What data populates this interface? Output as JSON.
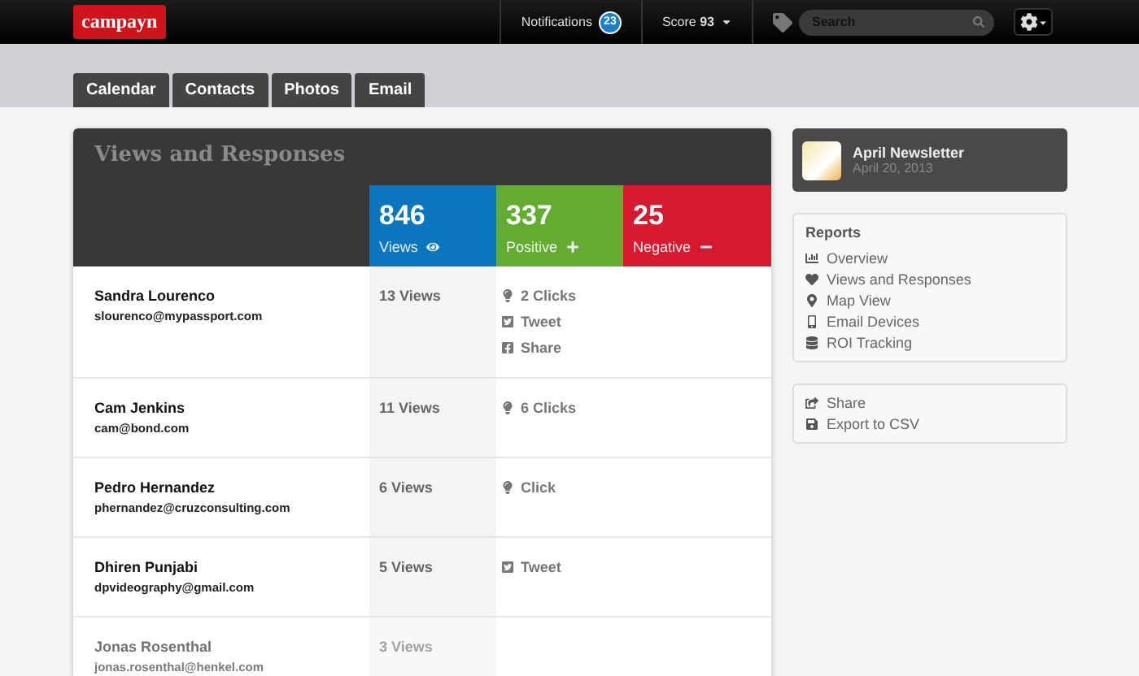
{
  "topbar": {
    "logo": "campayn",
    "notifications": {
      "label": "Notifications",
      "count": "23"
    },
    "score": {
      "label": "Score",
      "value": "93"
    },
    "search": {
      "placeholder": "Search"
    }
  },
  "tabs": [
    {
      "label": "Calendar",
      "selected": false
    },
    {
      "label": "Contacts",
      "selected": false
    },
    {
      "label": "Photos",
      "selected": false
    },
    {
      "label": "Email",
      "selected": false
    }
  ],
  "panel": {
    "title": "Views and Responses",
    "stats": [
      {
        "value": "846",
        "label": "Views",
        "kind": "views",
        "color": "#0b76bd"
      },
      {
        "value": "337",
        "label": "Positive",
        "kind": "positive",
        "color": "#62ac31"
      },
      {
        "value": "25",
        "label": "Negative",
        "kind": "negative",
        "color": "#d61a30"
      }
    ],
    "rows": [
      {
        "name": "Sandra Lourenco",
        "email": "slourenco@mypassport.com",
        "views": "13 Views",
        "faded": false,
        "responses": [
          {
            "kind": "click",
            "label": "2 Clicks"
          },
          {
            "kind": "tweet",
            "label": "Tweet"
          },
          {
            "kind": "share",
            "label": "Share"
          }
        ]
      },
      {
        "name": "Cam Jenkins",
        "email": "cam@bond.com",
        "views": "11 Views",
        "faded": false,
        "responses": [
          {
            "kind": "click",
            "label": "6 Clicks"
          }
        ]
      },
      {
        "name": "Pedro Hernandez",
        "email": "phernandez@cruzconsulting.com",
        "views": "6 Views",
        "faded": false,
        "responses": [
          {
            "kind": "click",
            "label": "Click"
          }
        ]
      },
      {
        "name": "Dhiren Punjabi",
        "email": "dpvideography@gmail.com",
        "views": "5 Views",
        "faded": false,
        "responses": [
          {
            "kind": "tweet",
            "label": "Tweet"
          }
        ]
      },
      {
        "name": "Jonas Rosenthal",
        "email": "jonas.rosenthal@henkel.com",
        "views": "3 Views",
        "faded": true,
        "responses": []
      }
    ]
  },
  "sidebar": {
    "newsletter": {
      "title": "April Newsletter",
      "date": "April 20, 2013"
    },
    "reports": {
      "heading": "Reports",
      "items": [
        {
          "kind": "overview",
          "label": "Overview"
        },
        {
          "kind": "heart",
          "label": "Views and Responses"
        },
        {
          "kind": "map",
          "label": "Map View"
        },
        {
          "kind": "device",
          "label": "Email Devices"
        },
        {
          "kind": "roi",
          "label": "ROI Tracking"
        }
      ]
    },
    "actions": [
      {
        "kind": "share",
        "label": "Share"
      },
      {
        "kind": "export",
        "label": "Export to CSV"
      }
    ]
  }
}
